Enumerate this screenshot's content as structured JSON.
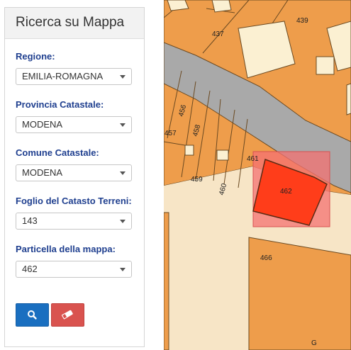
{
  "panel": {
    "title": "Ricerca su Mappa",
    "fields": [
      {
        "label": "Regione:",
        "value": "EMILIA-ROMAGNA"
      },
      {
        "label": "Provincia Catastale:",
        "value": "MODENA"
      },
      {
        "label": "Comune Catastale:",
        "value": "MODENA"
      },
      {
        "label": "Foglio del Catasto Terreni:",
        "value": "143"
      },
      {
        "label": "Particella della mappa:",
        "value": "462"
      }
    ],
    "buttons": {
      "search_icon": "search-icon",
      "clear_icon": "eraser-icon"
    }
  },
  "map": {
    "parcel_labels": [
      "437",
      "439",
      "456",
      "457",
      "458",
      "459",
      "460",
      "461",
      "462",
      "466",
      "G"
    ],
    "colors": {
      "parcel": "#ee9d4b",
      "road": "#a9a9a9",
      "street": "#f7e5c6",
      "building": "#fbf0d2",
      "highlight": "#ff3d1a",
      "selection_box": "#f47171"
    }
  }
}
